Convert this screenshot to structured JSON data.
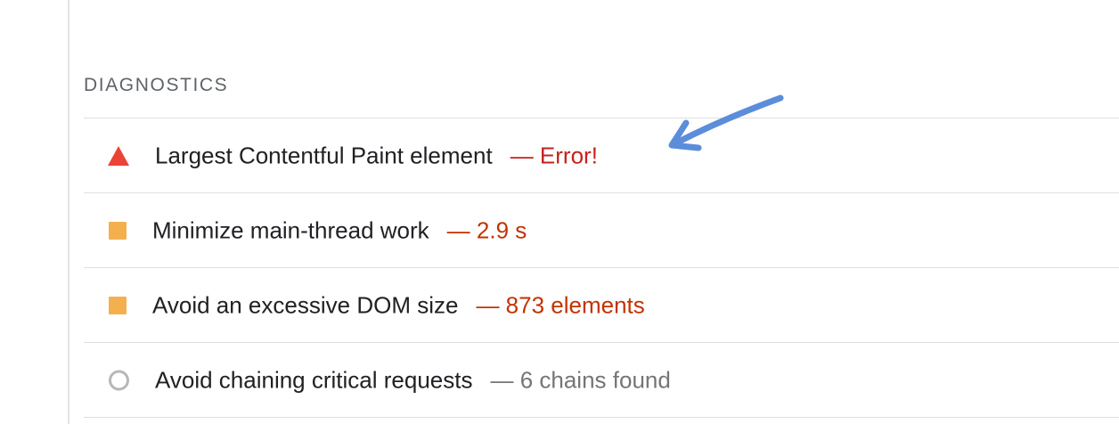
{
  "section": {
    "title": "DIAGNOSTICS"
  },
  "audits": [
    {
      "label": "Largest Contentful Paint element",
      "value": "— Error!",
      "status": "error",
      "icon": "triangle-error-icon",
      "color": "#eb4335"
    },
    {
      "label": "Minimize main-thread work",
      "value": "— 2.9 s",
      "status": "average",
      "icon": "square-warning-icon",
      "color": "#f4b04f"
    },
    {
      "label": "Avoid an excessive DOM size",
      "value": "— 873 elements",
      "status": "average",
      "icon": "square-warning-icon",
      "color": "#f4b04f"
    },
    {
      "label": "Avoid chaining critical requests",
      "value": "— 6 chains found",
      "status": "informative",
      "icon": "circle-info-icon",
      "color": "#b7b7b7"
    }
  ],
  "annotation": {
    "arrow_color": "#5b8ddb"
  }
}
